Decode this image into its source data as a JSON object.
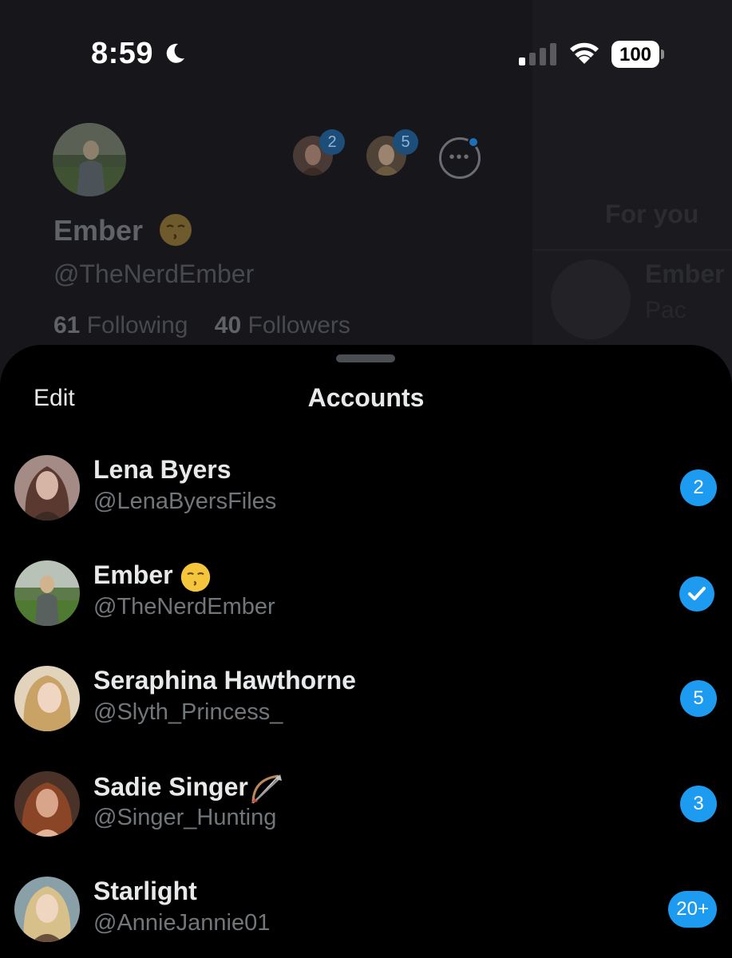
{
  "status_bar": {
    "time": "8:59",
    "battery": "100",
    "icons": [
      "moon-icon",
      "signal-icon",
      "wifi-icon",
      "battery-icon"
    ]
  },
  "background_profile": {
    "name": "Ember",
    "handle": "@TheNerdEmber",
    "following_count": "61",
    "following_label": "Following",
    "followers_count": "40",
    "followers_label": "Followers",
    "switch_accounts": [
      {
        "badge": "2"
      },
      {
        "badge": "5"
      }
    ],
    "more_icon": "more-options-icon"
  },
  "background_feed": {
    "tab_label": "For you",
    "post_name": "Ember",
    "post_snippet": "Pac"
  },
  "sheet": {
    "edit_label": "Edit",
    "title": "Accounts",
    "accounts": [
      {
        "name": "Lena Byers",
        "handle": "@LenaByersFiles",
        "badge": "2"
      },
      {
        "name": "Ember",
        "handle": "@TheNerdEmber",
        "selected": true
      },
      {
        "name": "Seraphina Hawthorne",
        "handle": "@Slyth_Princess_",
        "badge": "5"
      },
      {
        "name": "Sadie Singer",
        "handle": "@Singer_Hunting",
        "badge": "3"
      },
      {
        "name": "Starlight",
        "handle": "@AnnieJannie01",
        "badge": "20+"
      }
    ]
  },
  "colors": {
    "accent": "#1d9bf0",
    "sheet_bg": "#000000",
    "secondary_text": "#71767b"
  }
}
